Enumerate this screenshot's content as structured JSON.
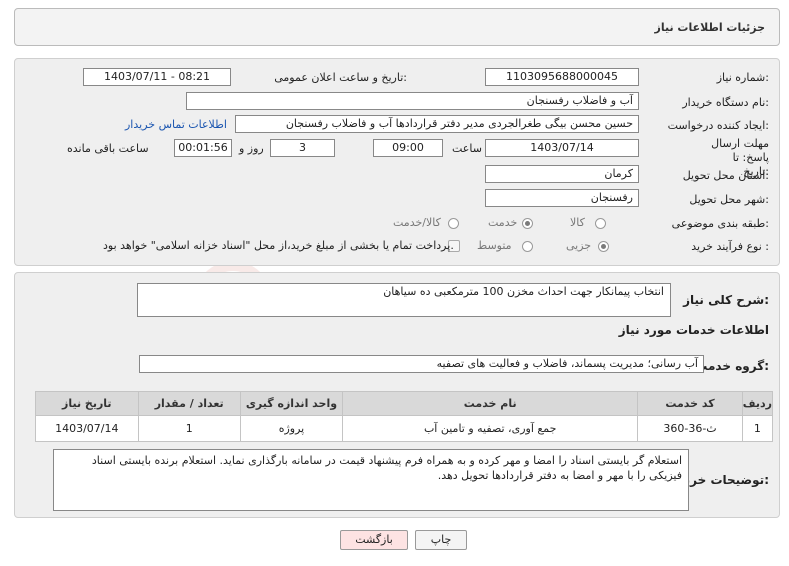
{
  "header": {
    "title": "جزئیات اطلاعات نیاز"
  },
  "details": {
    "need_number_label": "شماره نیاز:",
    "need_number": "1103095688000045",
    "announce_label": "تاریخ و ساعت اعلان عمومی:",
    "announce_value": "1403/07/11 - 08:21",
    "buyer_org_label": "نام دستگاه خریدار:",
    "buyer_org": "آب و فاضلاب رفسنجان",
    "requester_label": "ایجاد کننده درخواست:",
    "requester": "حسین محسن بیگی طغرالجردی مدیر دفتر قراردادها آب و فاضلاب رفسنجان",
    "contact_link": "اطلاعات تماس خریدار",
    "deadline_label": "مهلت ارسال پاسخ: تا تاریخ:",
    "deadline_date": "1403/07/14",
    "time_label": "ساعت",
    "deadline_time": "09:00",
    "days_value": "3",
    "days_label": "روز و",
    "remaining_time": "00:01:56",
    "remaining_label": "ساعت باقی مانده",
    "province_label": "استان محل تحویل:",
    "province": "کرمان",
    "city_label": "شهر محل تحویل:",
    "city": "رفسنجان",
    "category_label": "طبقه بندی موضوعی:",
    "category_options": [
      "کالا",
      "خدمت",
      "کالا/خدمت"
    ],
    "process_label": "نوع فرآیند خرید :",
    "process_options": [
      "جزیی",
      "متوسط"
    ],
    "payment_note": "پرداخت تمام یا بخشی از مبلغ خرید،از محل \"اسناد خزانه اسلامی\" خواهد بود."
  },
  "summary": {
    "label": "شرح کلی نیاز:",
    "text": "انتخاب پیمانکار جهت احداث مخزن 100 مترمکعبی ده سیاهان"
  },
  "services": {
    "section_title": "اطلاعات خدمات مورد نیاز",
    "group_label": "گروه خدمت:",
    "group_value": "آب رسانی؛ مدیریت پسماند، فاضلاب و فعالیت های تصفیه",
    "columns": [
      "ردیف",
      "کد خدمت",
      "نام خدمت",
      "واحد اندازه گیری",
      "تعداد / مقدار",
      "تاریخ نیاز"
    ],
    "rows": [
      [
        "1",
        "ث-36-360",
        "جمع آوری، تصفیه و تامین آب",
        "پروژه",
        "1",
        "1403/07/14"
      ]
    ]
  },
  "buyer_notes": {
    "label": "توضیحات خریدار:",
    "text": "استعلام گر بایستی اسناد را امضا و مهر کرده و به همراه فرم پیشنهاد قیمت در سامانه بارگذاری نماید. استعلام برنده بایستی اسناد فیزیکی را با مهر و امضا به دفتر قراردادها تحویل دهد."
  },
  "buttons": {
    "print": "چاپ",
    "back": "بازگشت"
  },
  "watermark_text": "AriaTender.net",
  "colors": {
    "accent_red": "#c0392b",
    "link_blue": "#1a55b0",
    "back_bg": "#fde3e3"
  }
}
